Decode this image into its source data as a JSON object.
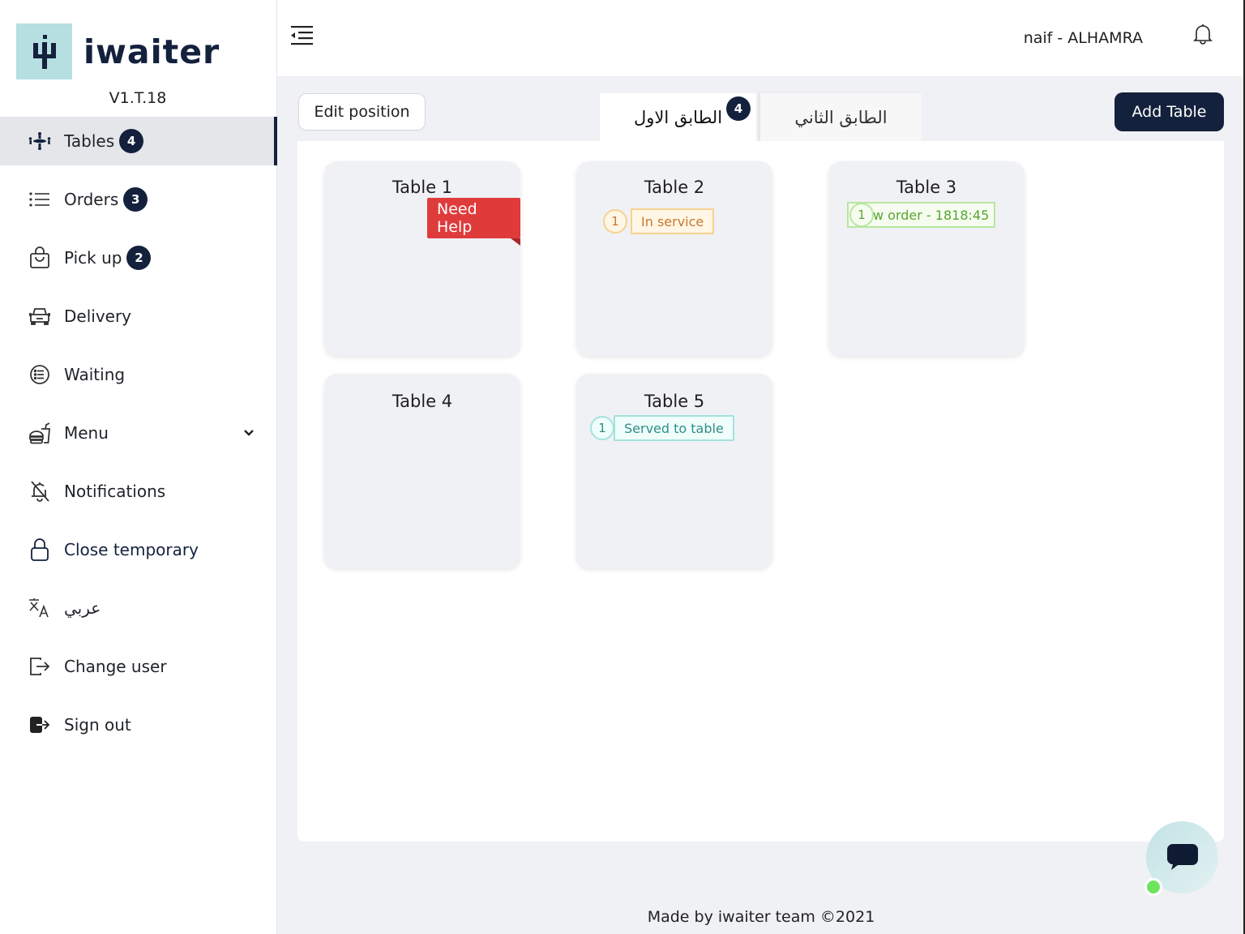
{
  "brand": {
    "name": "iwaiter",
    "version": "V1.T.18",
    "logo_color": "#b6dfe1",
    "primary_color": "#14213d"
  },
  "sidebar": {
    "items": [
      {
        "label": "Tables",
        "icon": "tables-icon",
        "badge": "4",
        "active": true
      },
      {
        "label": "Orders",
        "icon": "list-icon",
        "badge": "3"
      },
      {
        "label": "Pick up",
        "icon": "shopping-bag-icon",
        "badge": "2"
      },
      {
        "label": "Delivery",
        "icon": "car-icon"
      },
      {
        "label": "Waiting",
        "icon": "list-circle-icon"
      },
      {
        "label": "Menu",
        "icon": "food-icon",
        "expandable": true
      },
      {
        "label": "Notifications",
        "icon": "bell-off-icon"
      },
      {
        "label": "Close temporary",
        "icon": "lock-icon"
      },
      {
        "label": "عربي",
        "icon": "translate-icon"
      },
      {
        "label": "Change user",
        "icon": "change-user-icon"
      },
      {
        "label": "Sign out",
        "icon": "sign-out-icon"
      }
    ]
  },
  "header": {
    "user": "naif - ALHAMRA"
  },
  "toolbar": {
    "edit_position": "Edit position",
    "add_table": "Add Table"
  },
  "floors": {
    "tabs": [
      {
        "label": "الطابق الاول",
        "badge": "4",
        "active": true
      },
      {
        "label": "الطابق الثاني"
      }
    ]
  },
  "tables": [
    {
      "name": "Table 1",
      "alert": "Need Help"
    },
    {
      "name": "Table 2",
      "count": "1",
      "status": "In service",
      "status_color": "#c8772a"
    },
    {
      "name": "Table 3",
      "count": "1",
      "status": "New order - 1818:45",
      "status_visible": "w order - 1818:45",
      "status_color": "#57a530"
    },
    {
      "name": "Table 4"
    },
    {
      "name": "Table 5",
      "count": "1",
      "status": "Served to table",
      "status_color": "#2f8f86"
    }
  ],
  "footer": {
    "text": "Made by iwaiter team ©2021"
  },
  "chat": {
    "online": true,
    "status_color": "#6ee35d"
  }
}
